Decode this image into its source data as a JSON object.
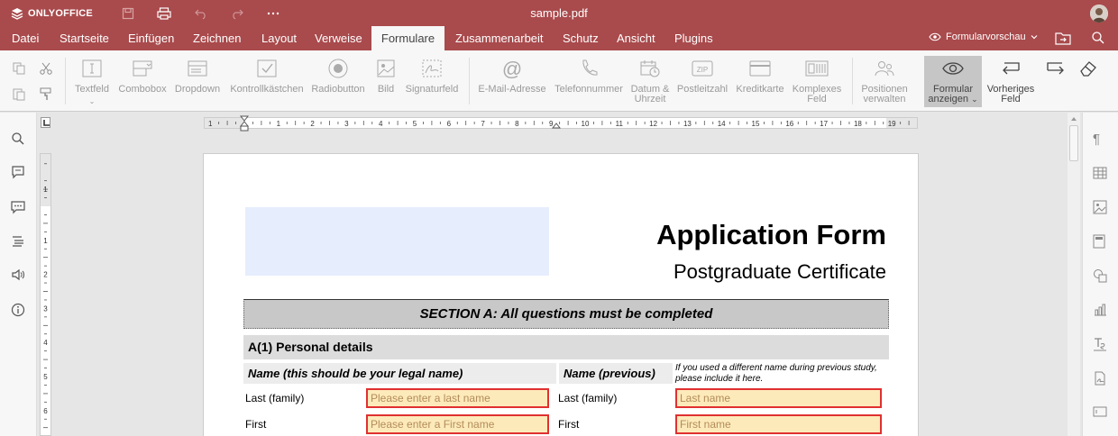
{
  "app": {
    "logo": "ONLYOFFICE",
    "filename": "sample.pdf"
  },
  "menu": {
    "items": [
      "Datei",
      "Startseite",
      "Einfügen",
      "Zeichnen",
      "Layout",
      "Verweise",
      "Formulare",
      "Zusammenarbeit",
      "Schutz",
      "Ansicht",
      "Plugins"
    ],
    "active": "Formulare",
    "preview_label": "Formularvorschau"
  },
  "ribbon": {
    "textfield": "Textfeld",
    "combobox": "Combobox",
    "dropdown": "Dropdown",
    "checkbox": "Kontrollkästchen",
    "radio": "Radiobutton",
    "image": "Bild",
    "signature": "Signaturfeld",
    "email": "E-Mail-Adresse",
    "phone": "Telefonnummer",
    "datetime_1": "Datum &",
    "datetime_2": "Uhrzeit",
    "zip": "Postleitzahl",
    "creditcard": "Kreditkarte",
    "complex_1": "Komplexes",
    "complex_2": "Feld",
    "positions_1": "Positionen",
    "positions_2": "verwalten",
    "show_form_1": "Formular",
    "show_form_2": "anzeigen",
    "prev_field_1": "Vorheriges",
    "prev_field_2": "Feld",
    "zip_icon_text": "ZIP"
  },
  "ruler": {
    "h_ticks": [
      "1",
      "1",
      "2",
      "3",
      "4",
      "5",
      "6",
      "7",
      "8",
      "9",
      "10",
      "11",
      "12",
      "13",
      "14",
      "15",
      "16",
      "17",
      "18",
      "19"
    ],
    "v_ticks": [
      "1",
      "1",
      "2",
      "3",
      "4",
      "5",
      "6"
    ]
  },
  "document": {
    "title": "Application Form",
    "subtitle": "Postgraduate Certificate",
    "section": "SECTION A: All questions must be completed",
    "subhead": "A(1) Personal details",
    "name_header": "Name (this should be your legal name)",
    "name_prev_header": "Name (previous)",
    "note": "If you used a different name during previous study, please include it here.",
    "rows": [
      {
        "label": "Last (family)",
        "placeholder": "Please enter a last name",
        "prev_label": "Last (family)",
        "prev_placeholder": "Last name"
      },
      {
        "label": "First",
        "placeholder": "Please enter a First name",
        "prev_label": "First",
        "prev_placeholder": "First name"
      }
    ]
  },
  "colors": {
    "brand": "#a94a4c",
    "field_bg": "#fdeaba",
    "field_border": "#e03030",
    "logo_placeholder": "#e6edfc"
  }
}
